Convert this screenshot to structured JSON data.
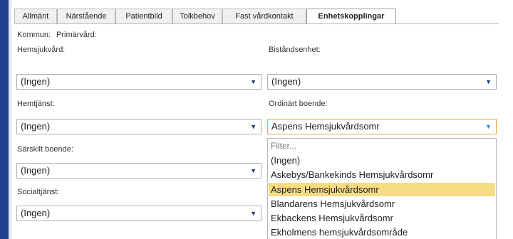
{
  "tabs": [
    "Allmänt",
    "Närstående",
    "Patientbild",
    "Tolkbehov",
    "Fast vårdkontakt",
    "Enhetskopplingar"
  ],
  "active_tab": "Enhetskopplingar",
  "kommun": {
    "label": "Kommun:",
    "value": "Primärvård:"
  },
  "fields": {
    "hemsjukvard": {
      "label": "Hemsjukvård:",
      "value": "(Ingen)"
    },
    "bistandsenhet": {
      "label": "Biståndsenhet:",
      "value": "(Ingen)"
    },
    "hemtjanst": {
      "label": "Hemtjänst:",
      "value": "(Ingen)"
    },
    "ordinart_boende": {
      "label": "Ordinärt boende:",
      "value": "Aspens Hemsjukvårdsomr"
    },
    "sarskilt_boende": {
      "label": "Särskilt boende:",
      "value": "(Ingen)"
    },
    "socialtjanst": {
      "label": "Socialtjänst:",
      "value": "(Ingen)"
    }
  },
  "dropdown": {
    "filter_placeholder": "Filter...",
    "options": [
      "(Ingen)",
      "Askebys/Bankekinds Hemsjukvårdsomr",
      "Aspens Hemsjukvårdsomr",
      "Blandarens Hemsjukvårdsomr",
      "Ekbackens Hemsjukvårdsomr",
      "Ekholmens hemsjukvårdsområde"
    ],
    "selected": "Aspens Hemsjukvårdsomr"
  },
  "icons": {
    "dropdown_arrow": "triangle-down-icon"
  }
}
